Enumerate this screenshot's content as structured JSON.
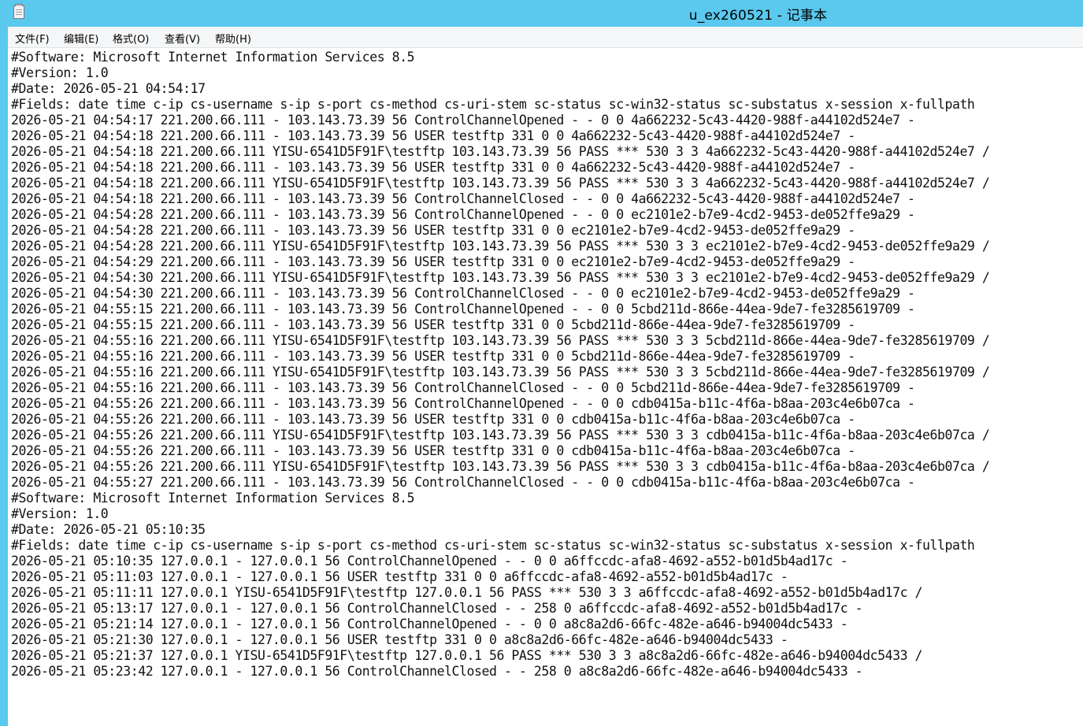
{
  "window": {
    "title": "u_ex260521 - 记事本",
    "app_icon": "notepad-icon"
  },
  "menu": [
    {
      "label": "文件(F)"
    },
    {
      "label": "编辑(E)"
    },
    {
      "label": "格式(O)"
    },
    {
      "label": "查看(V)"
    },
    {
      "label": "帮助(H)"
    }
  ],
  "lines": [
    "#Software: Microsoft Internet Information Services 8.5",
    "#Version: 1.0",
    "#Date: 2026-05-21 04:54:17",
    "#Fields: date time c-ip cs-username s-ip s-port cs-method cs-uri-stem sc-status sc-win32-status sc-substatus x-session x-fullpath",
    "2026-05-21 04:54:17 221.200.66.111 - 103.143.73.39 56 ControlChannelOpened - - 0 0 4a662232-5c43-4420-988f-a44102d524e7 -",
    "2026-05-21 04:54:18 221.200.66.111 - 103.143.73.39 56 USER testftp 331 0 0 4a662232-5c43-4420-988f-a44102d524e7 -",
    "2026-05-21 04:54:18 221.200.66.111 YISU-6541D5F91F\\testftp 103.143.73.39 56 PASS *** 530 3 3 4a662232-5c43-4420-988f-a44102d524e7 /",
    "2026-05-21 04:54:18 221.200.66.111 - 103.143.73.39 56 USER testftp 331 0 0 4a662232-5c43-4420-988f-a44102d524e7 -",
    "2026-05-21 04:54:18 221.200.66.111 YISU-6541D5F91F\\testftp 103.143.73.39 56 PASS *** 530 3 3 4a662232-5c43-4420-988f-a44102d524e7 /",
    "2026-05-21 04:54:18 221.200.66.111 - 103.143.73.39 56 ControlChannelClosed - - 0 0 4a662232-5c43-4420-988f-a44102d524e7 -",
    "2026-05-21 04:54:28 221.200.66.111 - 103.143.73.39 56 ControlChannelOpened - - 0 0 ec2101e2-b7e9-4cd2-9453-de052ffe9a29 -",
    "2026-05-21 04:54:28 221.200.66.111 - 103.143.73.39 56 USER testftp 331 0 0 ec2101e2-b7e9-4cd2-9453-de052ffe9a29 -",
    "2026-05-21 04:54:28 221.200.66.111 YISU-6541D5F91F\\testftp 103.143.73.39 56 PASS *** 530 3 3 ec2101e2-b7e9-4cd2-9453-de052ffe9a29 /",
    "2026-05-21 04:54:29 221.200.66.111 - 103.143.73.39 56 USER testftp 331 0 0 ec2101e2-b7e9-4cd2-9453-de052ffe9a29 -",
    "2026-05-21 04:54:30 221.200.66.111 YISU-6541D5F91F\\testftp 103.143.73.39 56 PASS *** 530 3 3 ec2101e2-b7e9-4cd2-9453-de052ffe9a29 /",
    "2026-05-21 04:54:30 221.200.66.111 - 103.143.73.39 56 ControlChannelClosed - - 0 0 ec2101e2-b7e9-4cd2-9453-de052ffe9a29 -",
    "2026-05-21 04:55:15 221.200.66.111 - 103.143.73.39 56 ControlChannelOpened - - 0 0 5cbd211d-866e-44ea-9de7-fe3285619709 -",
    "2026-05-21 04:55:15 221.200.66.111 - 103.143.73.39 56 USER testftp 331 0 0 5cbd211d-866e-44ea-9de7-fe3285619709 -",
    "2026-05-21 04:55:16 221.200.66.111 YISU-6541D5F91F\\testftp 103.143.73.39 56 PASS *** 530 3 3 5cbd211d-866e-44ea-9de7-fe3285619709 /",
    "2026-05-21 04:55:16 221.200.66.111 - 103.143.73.39 56 USER testftp 331 0 0 5cbd211d-866e-44ea-9de7-fe3285619709 -",
    "2026-05-21 04:55:16 221.200.66.111 YISU-6541D5F91F\\testftp 103.143.73.39 56 PASS *** 530 3 3 5cbd211d-866e-44ea-9de7-fe3285619709 /",
    "2026-05-21 04:55:16 221.200.66.111 - 103.143.73.39 56 ControlChannelClosed - - 0 0 5cbd211d-866e-44ea-9de7-fe3285619709 -",
    "2026-05-21 04:55:26 221.200.66.111 - 103.143.73.39 56 ControlChannelOpened - - 0 0 cdb0415a-b11c-4f6a-b8aa-203c4e6b07ca -",
    "2026-05-21 04:55:26 221.200.66.111 - 103.143.73.39 56 USER testftp 331 0 0 cdb0415a-b11c-4f6a-b8aa-203c4e6b07ca -",
    "2026-05-21 04:55:26 221.200.66.111 YISU-6541D5F91F\\testftp 103.143.73.39 56 PASS *** 530 3 3 cdb0415a-b11c-4f6a-b8aa-203c4e6b07ca /",
    "2026-05-21 04:55:26 221.200.66.111 - 103.143.73.39 56 USER testftp 331 0 0 cdb0415a-b11c-4f6a-b8aa-203c4e6b07ca -",
    "2026-05-21 04:55:26 221.200.66.111 YISU-6541D5F91F\\testftp 103.143.73.39 56 PASS *** 530 3 3 cdb0415a-b11c-4f6a-b8aa-203c4e6b07ca /",
    "2026-05-21 04:55:27 221.200.66.111 - 103.143.73.39 56 ControlChannelClosed - - 0 0 cdb0415a-b11c-4f6a-b8aa-203c4e6b07ca -",
    "#Software: Microsoft Internet Information Services 8.5",
    "#Version: 1.0",
    "#Date: 2026-05-21 05:10:35",
    "#Fields: date time c-ip cs-username s-ip s-port cs-method cs-uri-stem sc-status sc-win32-status sc-substatus x-session x-fullpath",
    "2026-05-21 05:10:35 127.0.0.1 - 127.0.0.1 56 ControlChannelOpened - - 0 0 a6ffccdc-afa8-4692-a552-b01d5b4ad17c -",
    "2026-05-21 05:11:03 127.0.0.1 - 127.0.0.1 56 USER testftp 331 0 0 a6ffccdc-afa8-4692-a552-b01d5b4ad17c -",
    "2026-05-21 05:11:11 127.0.0.1 YISU-6541D5F91F\\testftp 127.0.0.1 56 PASS *** 530 3 3 a6ffccdc-afa8-4692-a552-b01d5b4ad17c /",
    "2026-05-21 05:13:17 127.0.0.1 - 127.0.0.1 56 ControlChannelClosed - - 258 0 a6ffccdc-afa8-4692-a552-b01d5b4ad17c -",
    "2026-05-21 05:21:14 127.0.0.1 - 127.0.0.1 56 ControlChannelOpened - - 0 0 a8c8a2d6-66fc-482e-a646-b94004dc5433 -",
    "2026-05-21 05:21:30 127.0.0.1 - 127.0.0.1 56 USER testftp 331 0 0 a8c8a2d6-66fc-482e-a646-b94004dc5433 -",
    "2026-05-21 05:21:37 127.0.0.1 YISU-6541D5F91F\\testftp 127.0.0.1 56 PASS *** 530 3 3 a8c8a2d6-66fc-482e-a646-b94004dc5433 /",
    "2026-05-21 05:23:42 127.0.0.1 - 127.0.0.1 56 ControlChannelClosed - - 258 0 a8c8a2d6-66fc-482e-a646-b94004dc5433 -"
  ]
}
